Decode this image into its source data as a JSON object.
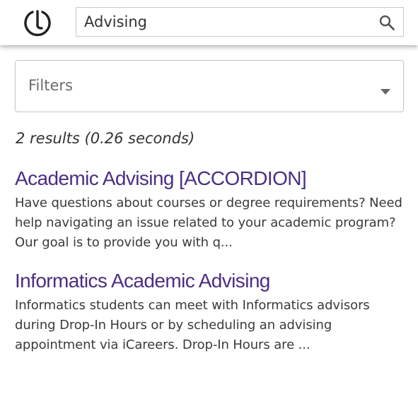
{
  "search": {
    "query": "Advising"
  },
  "filters": {
    "label": "Filters"
  },
  "results_summary": "2 results (0.26 seconds)",
  "results": [
    {
      "title": "Academic Advising [ACCORDION]",
      "snippet": "Have questions about courses or degree requirements? Need help navigating an issue related to your academic program? Our goal is to provide you with q..."
    },
    {
      "title": "Informatics Academic Advising",
      "snippet": "Informatics students can meet with Informatics advisors during Drop-In Hours or by scheduling an advising appointment via iCareers. Drop-In Hours are ..."
    }
  ],
  "colors": {
    "title_link": "#4b2e83",
    "text": "#3a3a3a",
    "border": "#c4c4c4"
  },
  "icons": {
    "logo": "logo-icon",
    "search": "search-icon",
    "filters_toggle": "caret-down-icon"
  }
}
